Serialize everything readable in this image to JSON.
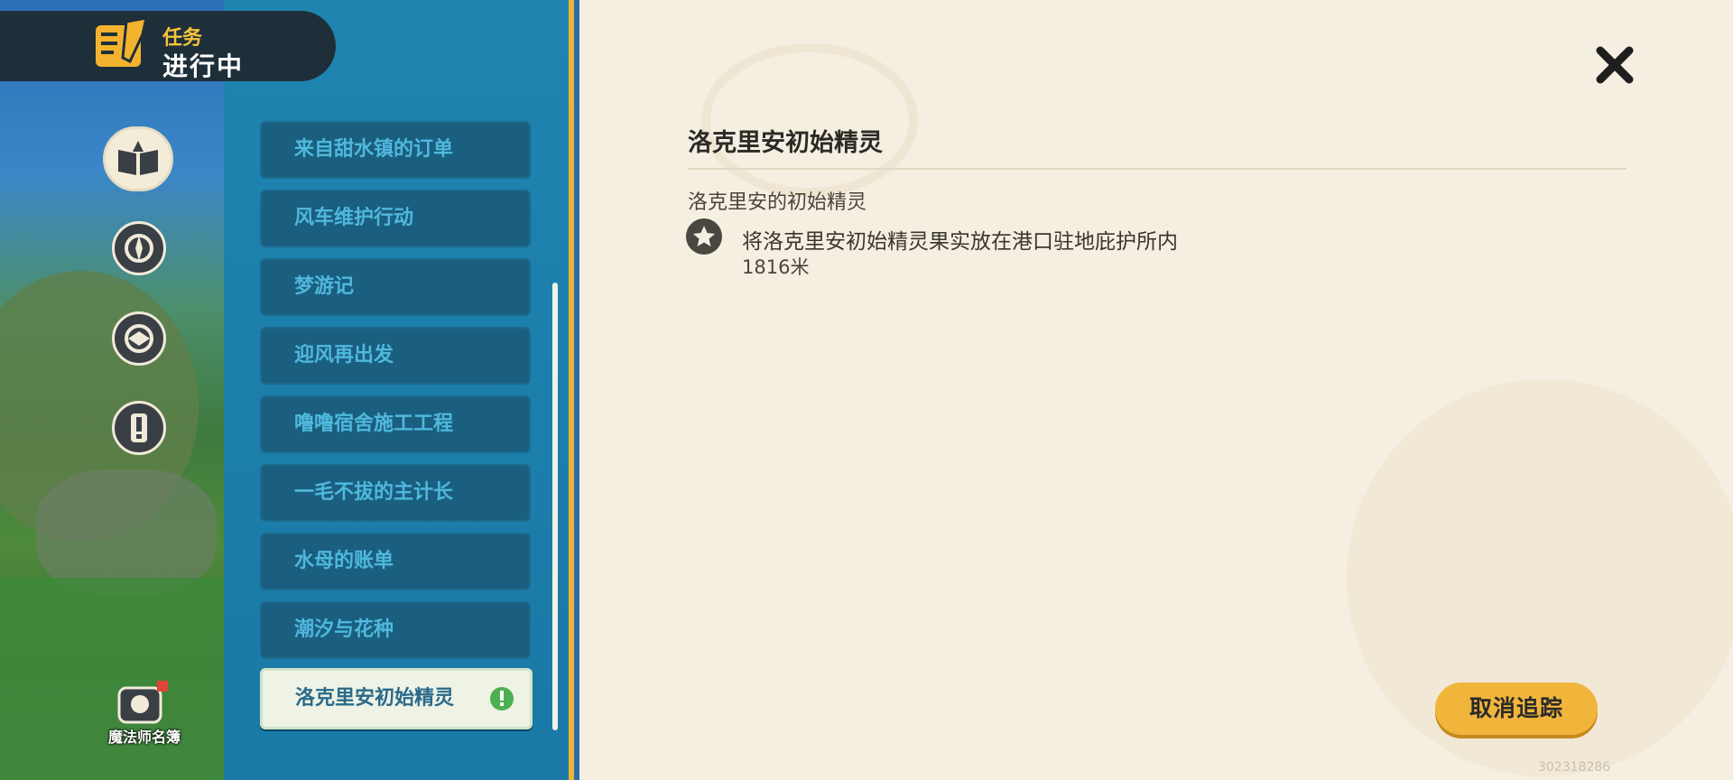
{
  "header": {
    "category": "任务",
    "status": "进行中"
  },
  "categories": [
    {
      "name": "story",
      "active": true
    },
    {
      "name": "side-a",
      "active": false
    },
    {
      "name": "side-b",
      "active": false
    },
    {
      "name": "alert",
      "active": false
    }
  ],
  "mage_book": {
    "label": "魔法师名簿"
  },
  "quests": [
    {
      "title": "来自甜水镇的订单"
    },
    {
      "title": "风车维护行动"
    },
    {
      "title": "梦游记"
    },
    {
      "title": "迎风再出发"
    },
    {
      "title": "噜噜宿舍施工工程"
    },
    {
      "title": "一毛不拔的主计长"
    },
    {
      "title": "水母的账单"
    },
    {
      "title": "潮汐与花种"
    },
    {
      "title": "洛克里安初始精灵"
    }
  ],
  "detail": {
    "title": "洛克里安初始精灵",
    "subtitle": "洛克里安的初始精灵",
    "objective": "将洛克里安初始精灵果实放在港口驻地庇护所内",
    "distance": "1816米",
    "cancel_label": "取消追踪"
  },
  "uid": "302318286",
  "colors": {
    "accent": "#f1b53c",
    "list_bg": "#1f84b0",
    "item_bg": "#1a5f80",
    "item_text": "#4fb8dc",
    "panel_bg": "#f5efe2"
  }
}
